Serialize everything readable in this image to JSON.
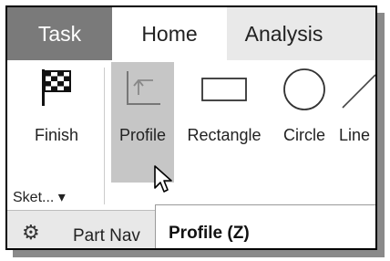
{
  "tabs": [
    {
      "label": "Task"
    },
    {
      "label": "Home"
    },
    {
      "label": "Analysis"
    }
  ],
  "ribbon": {
    "finish_label": "Finish",
    "profile_label": "Profile",
    "rectangle_label": "Rectangle",
    "circle_label": "Circle",
    "line_label": "Line",
    "sketch_group_label": "Sket... ▾"
  },
  "icons": {
    "finish": "checkered-flag-icon",
    "profile": "profile-icon",
    "rectangle": "rectangle-icon",
    "circle": "circle-icon",
    "line": "line-icon",
    "settings": "gear-icon",
    "cursor": "mouse-pointer-icon"
  },
  "bottom": {
    "part_navigator_label": "Part Nav"
  },
  "tooltip": {
    "text": "Profile (Z)"
  },
  "colors": {
    "active_tab": "#7a7a7a",
    "selected_tool": "#c6c6c6"
  }
}
